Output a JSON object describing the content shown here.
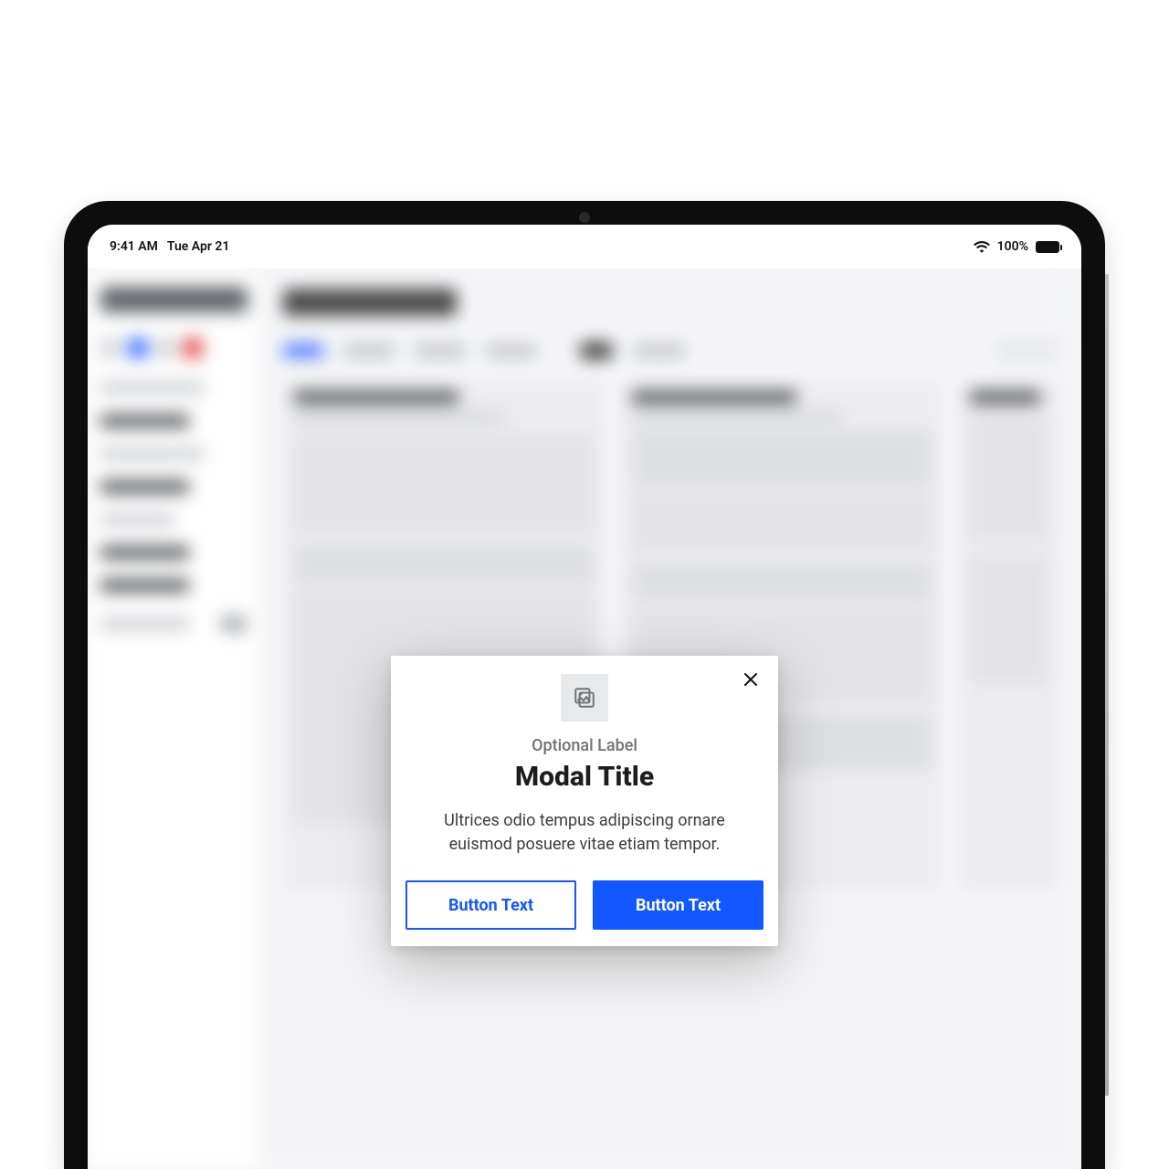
{
  "status_bar": {
    "time": "9:41 AM",
    "date": "Tue Apr 21",
    "battery_pct": "100%"
  },
  "modal": {
    "label": "Optional Label",
    "title": "Modal Title",
    "body": "Ultrices odio tempus adipiscing ornare euismod posuere vitae etiam tempor.",
    "secondary_button": "Button Text",
    "primary_button": "Button Text"
  },
  "colors": {
    "accent": "#1257ff"
  }
}
